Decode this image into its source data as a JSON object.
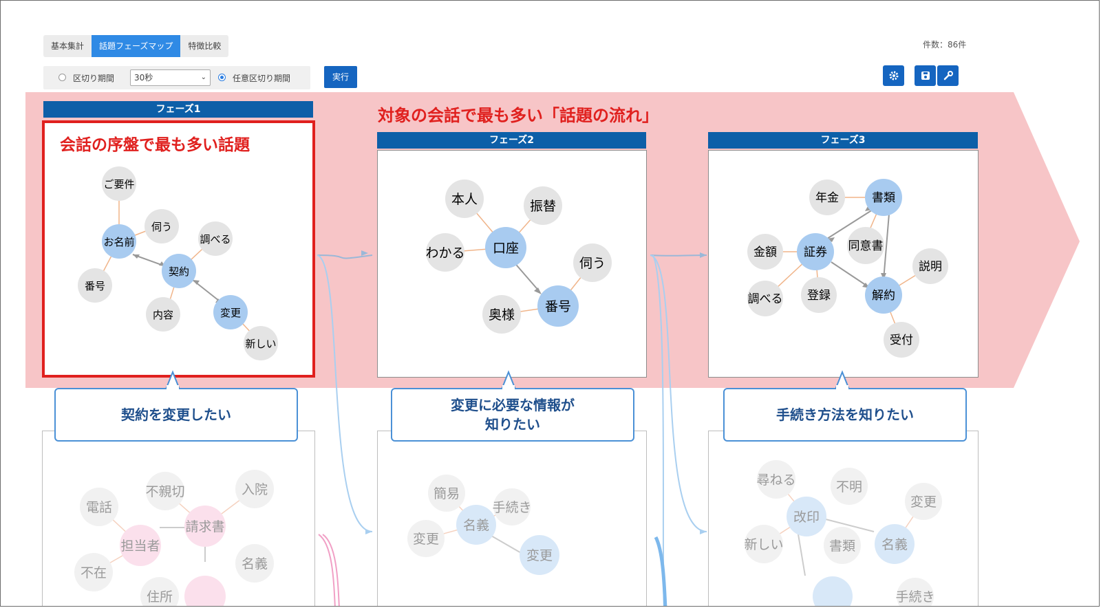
{
  "tabs": [
    "基本集計",
    "話題フェーズマップ",
    "特徴比較"
  ],
  "count": "件数：86件",
  "controls": {
    "radio1": "区切り期間",
    "select_value": "30秒",
    "radio2": "任意区切り期間",
    "run": "実行"
  },
  "toolbar_icons": [
    "gear-icon",
    "save-icon",
    "wrench-icon"
  ],
  "headline": "対象の会話で最も多い「話題の流れ」",
  "phase1_caption": "会話の序盤で最も多い話題",
  "phases": [
    {
      "label": "フェーズ1",
      "bubble": "契約を変更したい"
    },
    {
      "label": "フェーズ2",
      "bubble": "変更に必要な情報が\n知りたい"
    },
    {
      "label": "フェーズ3",
      "bubble": "手続き方法を知りたい"
    }
  ],
  "graphs": {
    "phase1": [
      "ご要件",
      "伺う",
      "お名前",
      "調べる",
      "契約",
      "番号",
      "内容",
      "変更",
      "新しい"
    ],
    "phase2": [
      "本人",
      "振替",
      "わかる",
      "口座",
      "伺う",
      "奥様",
      "番号"
    ],
    "phase3": [
      "年金",
      "書類",
      "金額",
      "証券",
      "同意書",
      "説明",
      "調べる",
      "登録",
      "解約",
      "受付"
    ],
    "lower1": [
      "電話",
      "不親切",
      "入院",
      "請求書",
      "担当者",
      "不在",
      "名義",
      "住所"
    ],
    "lower2": [
      "簡易",
      "手続き",
      "名義",
      "変更",
      "変更"
    ],
    "lower3": [
      "尋ねる",
      "不明",
      "変更",
      "改印",
      "新しい",
      "書類",
      "名義",
      "手続き"
    ]
  },
  "colors": {
    "accent_blue": "#1565c0",
    "phase_bar": "#0d5fa8",
    "highlight_red": "#e0201e",
    "pink_band": "#f7c5c7",
    "node_blue": "#a8cbf0",
    "node_gray": "#e4e4e4",
    "node_pink": "#f8d3e2"
  }
}
